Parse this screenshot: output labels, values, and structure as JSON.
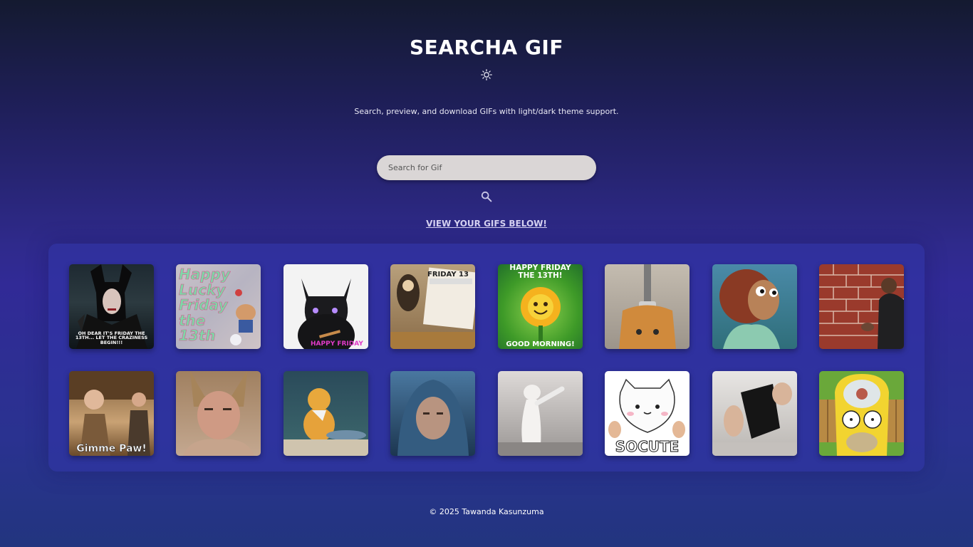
{
  "app": {
    "title": "SEARCHA GIF",
    "subtitle": "Search, preview, and download GIFs with light/dark theme support.",
    "theme_icon": "sun-icon"
  },
  "search": {
    "placeholder": "Search for Gif",
    "value": "",
    "icon": "search-icon"
  },
  "view_link": "VIEW YOUR GIFS BELOW!",
  "gifs": [
    {
      "caption": "OH DEAR IT'S FRIDAY THE 13TH... LET THE CRAZINESS BEGIN!!!"
    },
    {
      "caption": "Happy Lucky Friday the 13th"
    },
    {
      "caption": "HAPPY FRIDAY"
    },
    {
      "caption": "FRIDAY 13"
    },
    {
      "caption_top": "HAPPY FRIDAY THE 13TH!",
      "caption_bottom": "GOOD MORNING!"
    },
    {
      "caption": ""
    },
    {
      "caption": ""
    },
    {
      "caption": ""
    },
    {
      "caption": "Gimme Paw!"
    },
    {
      "caption": ""
    },
    {
      "caption": ""
    },
    {
      "caption": ""
    },
    {
      "caption": ""
    },
    {
      "caption": "SOCUTE"
    },
    {
      "caption": ""
    },
    {
      "caption": ""
    }
  ],
  "footer": "© 2025 Tawanda Kasunzuma",
  "colors": {
    "background_top": "#141a30",
    "background_mid": "#312a96",
    "gallery": "#3234aa",
    "search_field": "#dad6d6"
  }
}
